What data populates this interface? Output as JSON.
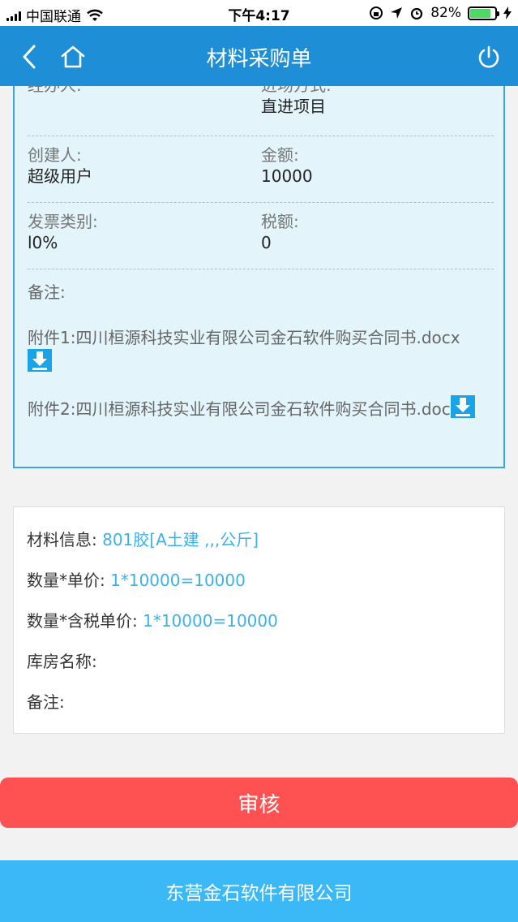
{
  "status_bar": {
    "carrier": "中国联通",
    "time": "下午4:17",
    "battery": "82%",
    "battery_level": 0.82
  },
  "nav": {
    "title": "材料采购单"
  },
  "order": {
    "handler_label": "经办人:",
    "handler_value": "",
    "entry_label": "进场方式:",
    "entry_value": "直进项目",
    "creator_label": "创建人:",
    "creator_value": "超级用户",
    "amount_label": "金额:",
    "amount_value": "10000",
    "invoice_label": "发票类别:",
    "invoice_value": "l0%",
    "tax_label": "税额:",
    "tax_value": "0",
    "remark_label": "备注:",
    "attachment1_label": "附件1:",
    "attachment1_name": "四川桓源科技实业有限公司金石软件购买合同书.docx",
    "attachment2_label": "附件2:",
    "attachment2_name": "四川桓源科技实业有限公司金石软件购买合同书.doc"
  },
  "material": {
    "info_label": "材料信息:",
    "info_value": "801胶[A土建 ,,,公斤]",
    "qty_price_label": "数量*单价:",
    "qty_price_value": "1*10000=10000",
    "qty_tax_price_label": "数量*含税单价:",
    "qty_tax_price_value": "1*10000=10000",
    "warehouse_label": "库房名称:",
    "remark_label": "备注:"
  },
  "actions": {
    "approve_label": "审核"
  },
  "footer": {
    "company": "东营金石软件有限公司"
  },
  "colors": {
    "nav": "#1e8fd6",
    "card_bg": "#e3f4fb",
    "accent_blue": "#3bb2ec",
    "approve": "#fe5151",
    "footer": "#3bb9f6"
  }
}
